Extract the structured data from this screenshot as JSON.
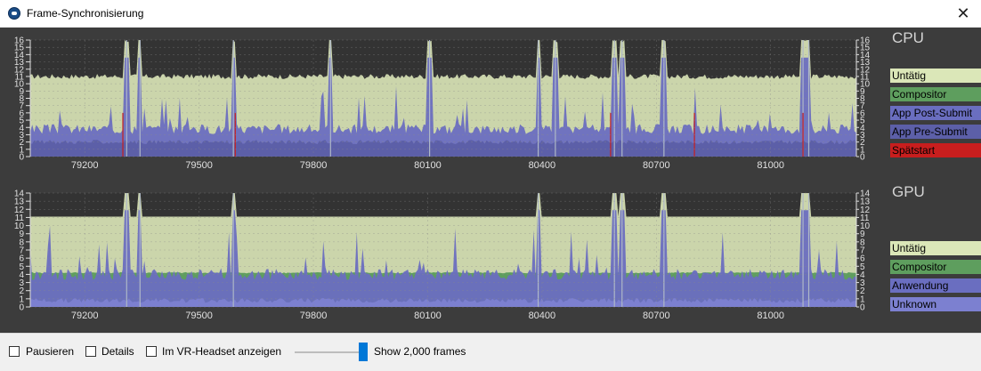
{
  "window": {
    "title": "Frame-Synchronisierung",
    "close_glyph": "✕"
  },
  "cpu": {
    "heading": "CPU",
    "legend": [
      {
        "label": "Untätig",
        "color": "#dbe7b8"
      },
      {
        "label": "Compositor",
        "color": "#5e9e5e"
      },
      {
        "label": "App Post-Submit",
        "color": "#6a6ec0"
      },
      {
        "label": "App Pre-Submit",
        "color": "#5c5fa8"
      },
      {
        "label": "Spätstart",
        "color": "#c81e1e"
      }
    ]
  },
  "gpu": {
    "heading": "GPU",
    "legend": [
      {
        "label": "Untätig",
        "color": "#dbe7b8"
      },
      {
        "label": "Compositor",
        "color": "#5e9e5e"
      },
      {
        "label": "Anwendung",
        "color": "#6a6ec0"
      },
      {
        "label": "Unknown",
        "color": "#7c80d0"
      }
    ]
  },
  "controls": {
    "pause_label": "Pausieren",
    "details_label": "Details",
    "headset_label": "Im VR-Headset anzeigen",
    "frames_label": "Show 2,000 frames",
    "pause_checked": false,
    "details_checked": false,
    "headset_checked": false
  },
  "chart_data": [
    {
      "type": "area",
      "title": "CPU",
      "x_ticks": [
        79200,
        79500,
        79800,
        80100,
        80400,
        80700,
        81000
      ],
      "xlim": [
        79057,
        81225
      ],
      "ylim": [
        0,
        16
      ],
      "y_ticks": [
        0,
        1,
        2,
        3,
        4,
        5,
        6,
        7,
        8,
        9,
        10,
        11,
        12,
        13,
        14,
        15,
        16
      ],
      "grid": true,
      "baseline_levels": {
        "Untätig": 11,
        "App Post-Submit": 3.5,
        "App Pre-Submit": 2
      },
      "spikes_x": [
        79310,
        79345,
        79590,
        79845,
        80105,
        80390,
        80435,
        80590,
        80610,
        80720,
        81085,
        81100
      ],
      "late_start_x": [
        79300,
        79595,
        80580,
        80800,
        81085
      ]
    },
    {
      "type": "area",
      "title": "GPU",
      "x_ticks": [
        79200,
        79500,
        79800,
        80100,
        80400,
        80700,
        81000
      ],
      "xlim": [
        79057,
        81225
      ],
      "ylim": [
        0,
        14
      ],
      "y_ticks": [
        0,
        1,
        2,
        3,
        4,
        5,
        6,
        7,
        8,
        9,
        10,
        11,
        12,
        13,
        14
      ],
      "grid": true,
      "baseline_levels": {
        "Untätig": 11.1,
        "Compositor": 4.2,
        "Anwendung": 3.7,
        "Unknown": 0.8
      },
      "spikes_x": [
        79310,
        79345,
        79590,
        80390,
        80590,
        80610,
        80720,
        81085,
        81100
      ]
    }
  ]
}
